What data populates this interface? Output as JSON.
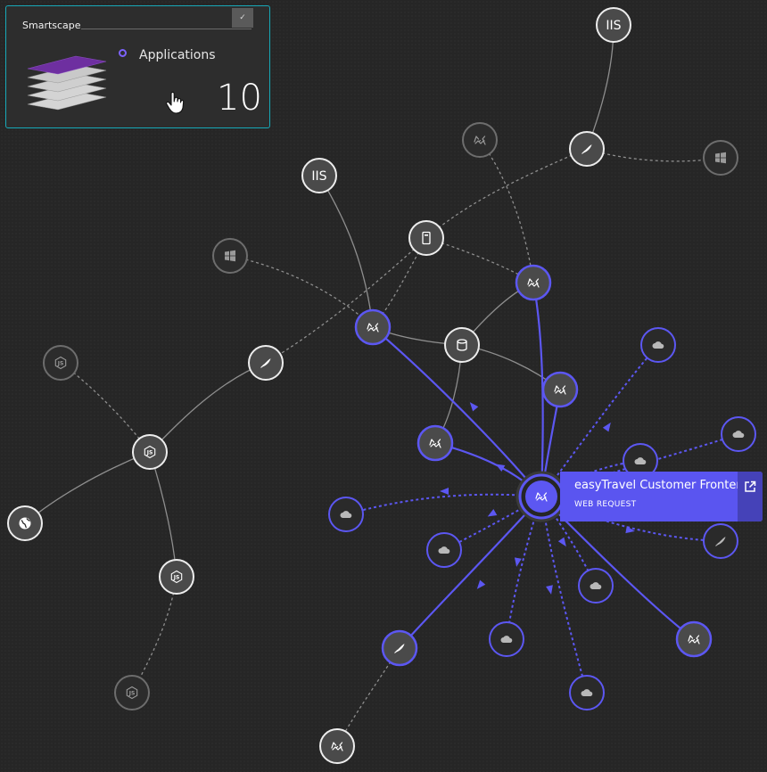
{
  "card": {
    "title": "Smartscape",
    "legend_label": "Applications",
    "count": "10"
  },
  "tooltip": {
    "name": "easyTravel Customer Frontend",
    "type": "WEB REQUEST"
  },
  "colors": {
    "accent": "#5a55f0",
    "link_active": "#5c57f2",
    "link_inactive": "#8e8e8e",
    "card_border": "#17a9b8"
  }
}
